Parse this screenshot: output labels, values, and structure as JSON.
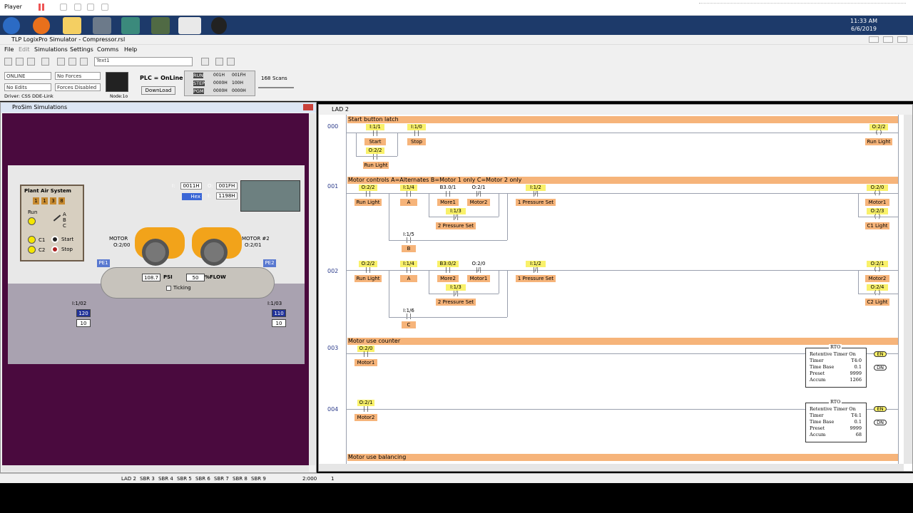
{
  "player": {
    "label": "Player"
  },
  "taskbar": {
    "time": "11:33 AM",
    "date": "6/6/2019"
  },
  "app": {
    "title": "TLP LogixPro Simulator - Compressor.rsl"
  },
  "menu": [
    "File",
    "Edit",
    "Simulations",
    "Settings",
    "Comms",
    "Help"
  ],
  "toolbar": {
    "text_field": "Text1"
  },
  "plc": {
    "mode": "ONLINE",
    "forces": "No Forces",
    "edits": "No Edits",
    "forces_state": "Forces Disabled",
    "driver": "Driver: CSS DDE-Link",
    "node": "Node:1o",
    "status": "PLC = OnLine",
    "download": "DownLoad",
    "run": "RUN",
    "step": "STEP",
    "pgm": "PGM",
    "r1a": "001H",
    "r1b": "001FH",
    "r2a": "0000H",
    "r2b": "100H",
    "r3a": "0000H",
    "r3b": "0000H",
    "scans": "168",
    "scans_label": "Scans"
  },
  "prosim": {
    "title": "ProSim Simulations",
    "panel_title": "Plant Air System",
    "counter": [
      "1",
      "1",
      "3",
      "8"
    ],
    "run": "Run",
    "a": "A",
    "b": "B",
    "c": "C",
    "c1": "C1",
    "c2": "C2",
    "start": "Start",
    "stop": "Stop",
    "motor1": "MOTOR",
    "motor1_addr": "O:2/00",
    "motor2": "MOTOR #2",
    "motor2_addr": "O:2/01",
    "pe1": "PE1",
    "pe2": "PE2",
    "psi_val": "108.7",
    "psi": "PSI",
    "flow_val": "50",
    "flow": "%FLOW",
    "ticking": "Ticking",
    "i1": "I:",
    "i1v": "0011H",
    "o1": "O:",
    "o1v": "001FH",
    "hex": "Hex",
    "i2": "I:",
    "i2v": "0011H",
    "o2": "O:",
    "o2v": "1198H",
    "s1": "I:1/02",
    "s1a": "120",
    "s1b": "10",
    "s2": "I:1/03",
    "s2a": "110",
    "s2b": "10"
  },
  "lad": {
    "title": "LAD 2",
    "r000": {
      "num": "000",
      "title": "Start button latch",
      "a1": "I:1/1",
      "s1": "Start",
      "a2": "I:1/0",
      "s2": "Stop",
      "a3": "O:2/2",
      "s3": "Run Light",
      "ca": "O:2/2",
      "cs": "Run Light"
    },
    "r001": {
      "num": "001",
      "title": "Motor controls A=Alternates B=Motor 1 only C=Motor 2 only",
      "a1": "O:2/2",
      "s1": "Run Light",
      "a2": "I:1/4",
      "s2": "A",
      "a3": "B3.0/1",
      "s3": "More1",
      "a4": "O:2/1",
      "s4": "Motor2",
      "a5": "I:1/3",
      "s5": "2 Pressure Set",
      "a6": "I:1/2",
      "s6": "1 Pressure Set",
      "a7": "I:1/5",
      "s7": "B",
      "c1a": "O:2/0",
      "c1s": "Motor1",
      "c2a": "O:2/3",
      "c2s": "C1 Light"
    },
    "r002": {
      "num": "002",
      "a1": "O:2/2",
      "s1": "Run Light",
      "a2": "I:1/4",
      "s2": "A",
      "a3": "B3:0/2",
      "s3": "More2",
      "a4": "O:2/0",
      "s4": "Motor1",
      "a5": "I:1/3",
      "s5": "2 Pressure Set",
      "a6": "I:1/2",
      "s6": "1 Pressure Set",
      "a7": "I:1/6",
      "s7": "C",
      "c1a": "O:2/1",
      "c1s": "Motor2",
      "c2a": "O:2/4",
      "c2s": "C2 Light"
    },
    "r003": {
      "num": "003",
      "title": "Motor use counter",
      "a1": "O:2/0",
      "s1": "Motor1",
      "rto": "RTO",
      "rto_title": "Retentive Timer On",
      "timer": "Timer",
      "timer_v": "T4:0",
      "tb": "Time Base",
      "tb_v": "0.1",
      "pre": "Preset",
      "pre_v": "9999",
      "acc": "Accum",
      "acc_v": "1266",
      "en": "EN",
      "dn": "DN"
    },
    "r004": {
      "num": "004",
      "a1": "O:2/1",
      "s1": "Motor2",
      "rto": "RTO",
      "rto_title": "Retentive Timer On",
      "timer": "Timer",
      "timer_v": "T4:1",
      "tb": "Time Base",
      "tb_v": "0.1",
      "pre": "Preset",
      "pre_v": "9999",
      "acc": "Accum",
      "acc_v": "68",
      "en": "EN",
      "dn": "DN"
    },
    "r005": {
      "title": "Motor use balancing"
    }
  },
  "status": {
    "tabs": [
      "LAD 2",
      "SBR 3",
      "SBR 4",
      "SBR 5",
      "SBR 6",
      "SBR 7",
      "SBR 8",
      "SBR 9"
    ],
    "coord": "2:000",
    "rung": "1"
  }
}
